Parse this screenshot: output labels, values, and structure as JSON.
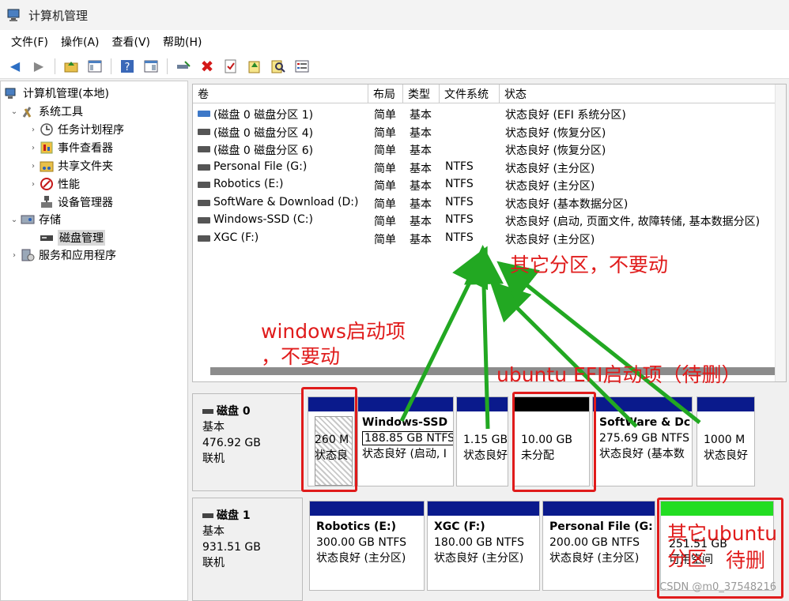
{
  "window": {
    "title": "计算机管理"
  },
  "menu": [
    {
      "label": "文件(F)"
    },
    {
      "label": "操作(A)"
    },
    {
      "label": "查看(V)"
    },
    {
      "label": "帮助(H)"
    }
  ],
  "tree": {
    "root": "计算机管理(本地)",
    "system_tools": "系统工具",
    "task_scheduler": "任务计划程序",
    "event_viewer": "事件查看器",
    "shared_folders": "共享文件夹",
    "performance": "性能",
    "device_manager": "设备管理器",
    "storage": "存储",
    "disk_management": "磁盘管理",
    "services": "服务和应用程序"
  },
  "volume_table": {
    "columns": [
      "卷",
      "布局",
      "类型",
      "文件系统",
      "状态"
    ],
    "rows": [
      {
        "name": "(磁盘 0 磁盘分区 1)",
        "layout": "简单",
        "type": "基本",
        "fs": "",
        "status": "状态良好 (EFI 系统分区)"
      },
      {
        "name": "(磁盘 0 磁盘分区 4)",
        "layout": "简单",
        "type": "基本",
        "fs": "",
        "status": "状态良好 (恢复分区)"
      },
      {
        "name": "(磁盘 0 磁盘分区 6)",
        "layout": "简单",
        "type": "基本",
        "fs": "",
        "status": "状态良好 (恢复分区)"
      },
      {
        "name": "Personal File (G:)",
        "layout": "简单",
        "type": "基本",
        "fs": "NTFS",
        "status": "状态良好 (主分区)"
      },
      {
        "name": "Robotics (E:)",
        "layout": "简单",
        "type": "基本",
        "fs": "NTFS",
        "status": "状态良好 (主分区)"
      },
      {
        "name": "SoftWare & Download (D:)",
        "layout": "简单",
        "type": "基本",
        "fs": "NTFS",
        "status": "状态良好 (基本数据分区)"
      },
      {
        "name": "Windows-SSD (C:)",
        "layout": "简单",
        "type": "基本",
        "fs": "NTFS",
        "status": "状态良好 (启动, 页面文件, 故障转储, 基本数据分区)"
      },
      {
        "name": "XGC (F:)",
        "layout": "简单",
        "type": "基本",
        "fs": "NTFS",
        "status": "状态良好 (主分区)"
      }
    ]
  },
  "disks": [
    {
      "name": "磁盘 0",
      "kind": "基本",
      "size": "476.92 GB",
      "state": "联机",
      "partitions": [
        {
          "name": "",
          "size": "260 M",
          "status": "状态良"
        },
        {
          "name": "Windows-SSD",
          "size": "188.85 GB NTFS",
          "status": "状态良好 (启动, I"
        },
        {
          "name": "",
          "size": "1.15 GB",
          "status": "状态良好"
        },
        {
          "name": "",
          "size": "10.00 GB",
          "status": "未分配"
        },
        {
          "name": "SoftWare & Dc",
          "size": "275.69 GB NTFS",
          "status": "状态良好 (基本数"
        },
        {
          "name": "",
          "size": "1000 M",
          "status": "状态良好"
        }
      ]
    },
    {
      "name": "磁盘 1",
      "kind": "基本",
      "size": "931.51 GB",
      "state": "联机",
      "partitions": [
        {
          "name": "Robotics  (E:)",
          "size": "300.00 GB NTFS",
          "status": "状态良好 (主分区)"
        },
        {
          "name": "XGC  (F:)",
          "size": "180.00 GB NTFS",
          "status": "状态良好 (主分区)"
        },
        {
          "name": "Personal File  (G:",
          "size": "200.00 GB NTFS",
          "status": "状态良好 (主分区)"
        },
        {
          "name": "",
          "size": "251.51 GB",
          "status": "可用空间"
        }
      ]
    }
  ],
  "annotations": {
    "other_partitions": "其它分区，不要动",
    "windows_boot_1": "windows启动项",
    "windows_boot_2": "，不要动",
    "ubuntu_efi": "ubuntu EFI启动项（待删）",
    "other_ubuntu_1": "其它ubuntu",
    "other_ubuntu_2": "分区",
    "other_ubuntu_3": "待删"
  },
  "watermark": "CSDN @m0_37548216",
  "colors": {
    "annotation_red": "#e01b1b",
    "arrow_green": "#22a822",
    "partition_bar_blue": "#0a1a8c",
    "free_space_green": "#22dd22"
  }
}
